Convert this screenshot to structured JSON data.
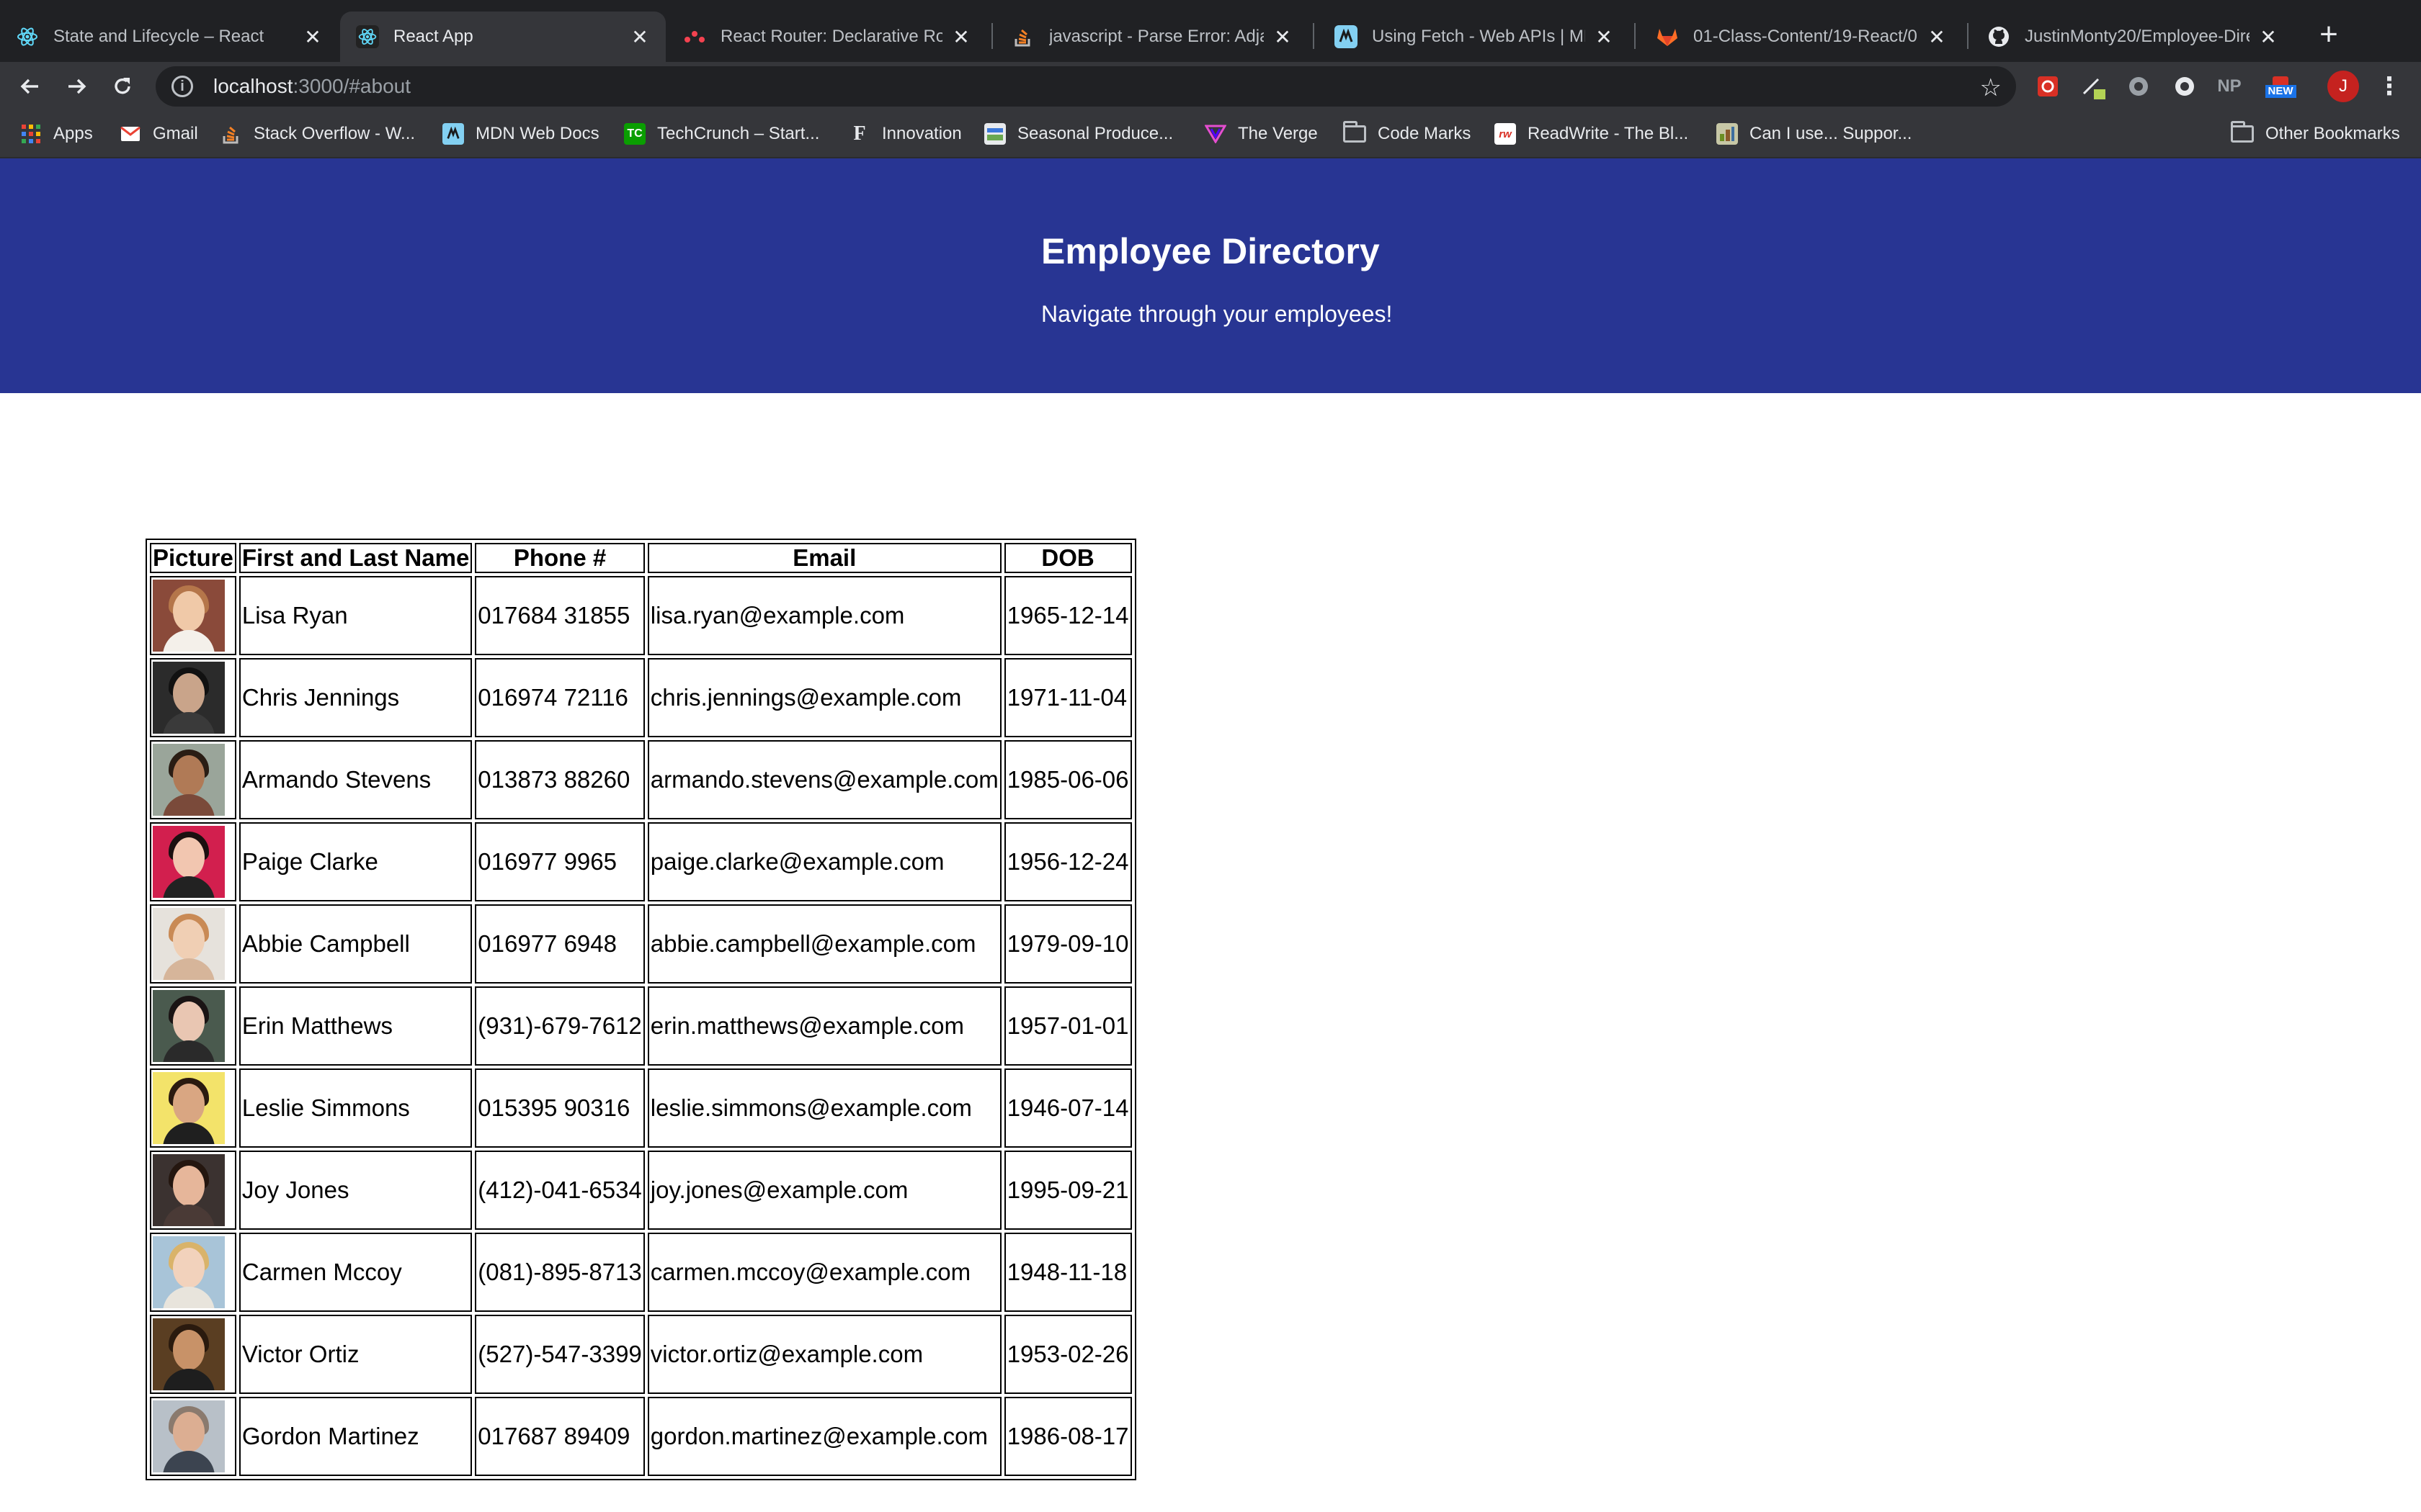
{
  "browser": {
    "tabs": [
      {
        "title": "State and Lifecycle – React",
        "icon": "react-icon",
        "active": false
      },
      {
        "title": "React App",
        "icon": "react-icon",
        "active": true
      },
      {
        "title": "React Router: Declarative Rou",
        "icon": "react-router-icon",
        "active": false
      },
      {
        "title": "javascript - Parse Error: Adjac",
        "icon": "stackoverflow-icon",
        "active": false
      },
      {
        "title": "Using Fetch - Web APIs | MDN",
        "icon": "mdn-icon",
        "active": false
      },
      {
        "title": "01-Class-Content/19-React/0",
        "icon": "gitlab-icon",
        "active": false
      },
      {
        "title": "JustinMonty20/Employee-Dire",
        "icon": "github-icon",
        "active": false
      }
    ],
    "url": {
      "host": "localhost",
      "rest": ":3000/#about"
    },
    "avatar_letter": "J",
    "extension_badges": {
      "np": "NP",
      "new": "NEW"
    },
    "bookmarks": [
      {
        "label": "Apps",
        "icon": "apps-grid-icon"
      },
      {
        "label": "Gmail",
        "icon": "gmail-icon"
      },
      {
        "label": "Stack Overflow - W...",
        "icon": "stackoverflow-icon"
      },
      {
        "label": "MDN Web Docs",
        "icon": "mdn-icon"
      },
      {
        "label": "TechCrunch – Start...",
        "icon": "techcrunch-icon"
      },
      {
        "label": "Innovation",
        "icon": "innovation-icon"
      },
      {
        "label": "Seasonal Produce...",
        "icon": "produce-icon"
      },
      {
        "label": "The Verge",
        "icon": "verge-icon"
      },
      {
        "label": "Code Marks",
        "icon": "folder-icon"
      },
      {
        "label": "ReadWrite - The Bl...",
        "icon": "readwrite-icon"
      },
      {
        "label": "Can I use... Suppor...",
        "icon": "caniuse-icon"
      }
    ],
    "other_bookmarks": "Other Bookmarks"
  },
  "header": {
    "title": "Employee Directory",
    "subtitle": "Navigate through your employees!"
  },
  "table": {
    "columns": [
      "Picture",
      "First and Last Name",
      "Phone #",
      "Email",
      "DOB"
    ],
    "rows": [
      {
        "name": "Lisa Ryan",
        "phone": "017684 31855",
        "email": "lisa.ryan@example.com",
        "dob": "1965-12-14"
      },
      {
        "name": "Chris Jennings",
        "phone": "016974 72116",
        "email": "chris.jennings@example.com",
        "dob": "1971-11-04"
      },
      {
        "name": "Armando Stevens",
        "phone": "013873 88260",
        "email": "armando.stevens@example.com",
        "dob": "1985-06-06"
      },
      {
        "name": "Paige Clarke",
        "phone": "016977 9965",
        "email": "paige.clarke@example.com",
        "dob": "1956-12-24"
      },
      {
        "name": "Abbie Campbell",
        "phone": "016977 6948",
        "email": "abbie.campbell@example.com",
        "dob": "1979-09-10"
      },
      {
        "name": "Erin Matthews",
        "phone": "(931)-679-7612",
        "email": "erin.matthews@example.com",
        "dob": "1957-01-01"
      },
      {
        "name": "Leslie Simmons",
        "phone": "015395 90316",
        "email": "leslie.simmons@example.com",
        "dob": "1946-07-14"
      },
      {
        "name": "Joy Jones",
        "phone": "(412)-041-6534",
        "email": "joy.jones@example.com",
        "dob": "1995-09-21"
      },
      {
        "name": "Carmen Mccoy",
        "phone": "(081)-895-8713",
        "email": "carmen.mccoy@example.com",
        "dob": "1948-11-18"
      },
      {
        "name": "Victor Ortiz",
        "phone": "(527)-547-3399",
        "email": "victor.ortiz@example.com",
        "dob": "1953-02-26"
      },
      {
        "name": "Gordon Martinez",
        "phone": "017687 89409",
        "email": "gordon.martinez@example.com",
        "dob": "1986-08-17"
      }
    ]
  },
  "colors": {
    "header_background": "#283593",
    "chrome_frame": "#202124",
    "chrome_toolbar": "#35363a"
  }
}
